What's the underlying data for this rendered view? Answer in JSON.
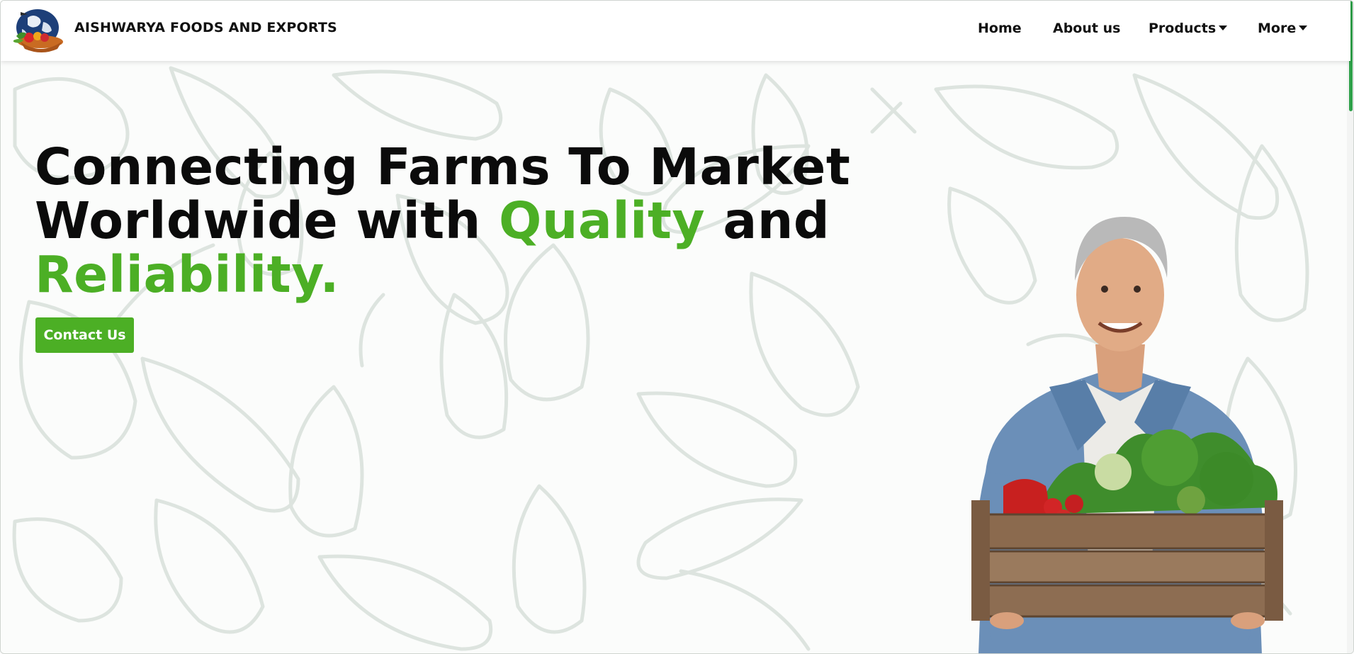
{
  "header": {
    "brand": "AISHWARYA FOODS AND EXPORTS",
    "nav": [
      {
        "label": "Home",
        "dropdown": false
      },
      {
        "label": "About us",
        "dropdown": false
      },
      {
        "label": "Products",
        "dropdown": true
      },
      {
        "label": "More",
        "dropdown": true
      }
    ]
  },
  "hero": {
    "headline_line1": "Connecting Farms To Market",
    "headline_line2_a": "Worldwide with ",
    "headline_line2_highlight": "Quality",
    "headline_line2_b": " and",
    "headline_line3_highlight": "Reliability.",
    "cta_label": "Contact Us"
  },
  "theme": {
    "accent": "#4caf25",
    "text": "#0b0b0b",
    "background": "#fbfcfb",
    "scroll_thumb": "#2fa14a"
  },
  "icons": [
    "globe-basket-logo-icon",
    "caret-down-icon",
    "vegetable-doodle-pattern",
    "farmer-with-crate-image"
  ]
}
